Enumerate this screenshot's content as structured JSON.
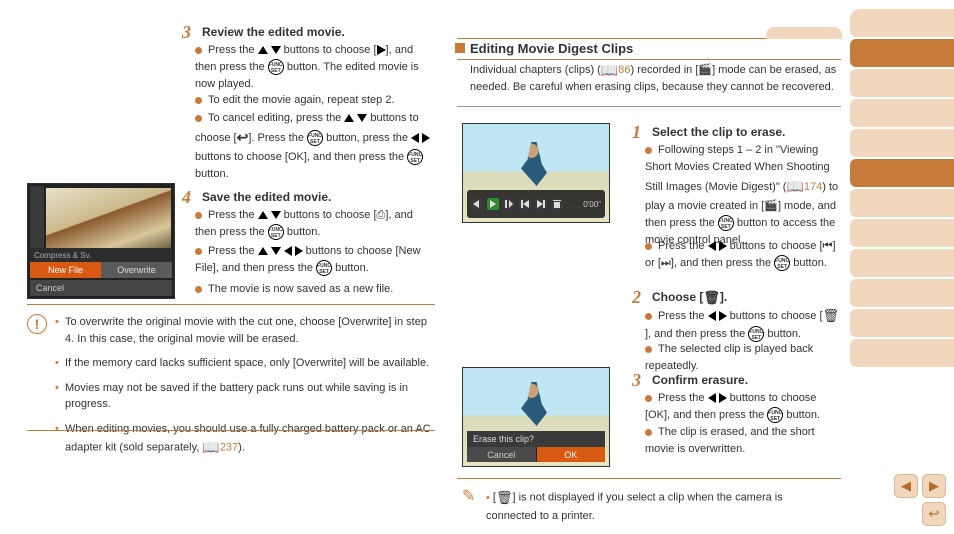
{
  "left": {
    "step3": {
      "num": "3",
      "title": "Review the edited movie.",
      "b1a": "Press the ",
      "b1b": " buttons to choose [",
      "b1c": "], and then press the ",
      "b1d": " button. The edited movie is now played.",
      "b2": "To edit the movie again, repeat step 2.",
      "b3a": "To cancel editing, press the ",
      "b3b": " buttons to choose [",
      "b3c": "]. Press the ",
      "b3d": " button, press the ",
      "b3e": " buttons to choose [OK], and then press the ",
      "b3f": " button."
    },
    "step4": {
      "num": "4",
      "title": "Save the edited movie.",
      "b1a": "Press the ",
      "b1b": " buttons to choose [",
      "b1c": "], and then press the ",
      "b1d": " button.",
      "b2a": "Press the ",
      "b2b": " buttons to choose [New File], and then press the ",
      "b2c": " button.",
      "b3": "The movie is now saved as a new file."
    },
    "shot": {
      "bar": "Compress & Sv.",
      "new": "New File",
      "ow": "Overwrite",
      "cancel": "Cancel"
    },
    "caution": {
      "c1": "To overwrite the original movie with the cut one, choose [Overwrite] in step 4. In this case, the original movie will be erased.",
      "c2": "If the memory card lacks sufficient space, only [Overwrite] will be available.",
      "c3": "Movies may not be saved if the battery pack runs out while saving is in progress.",
      "c4a": "When editing movies, you should use a fully charged battery pack or an AC adapter kit (sold separately, ",
      "c4b": "237",
      "c4c": ")."
    }
  },
  "right": {
    "header": {
      "title": "Editing Movie Digest Clips",
      "subA": "Individual chapters (clips) (",
      "subB": "86",
      "subC": ") recorded in [",
      "subD": "] mode can be erased, as needed. Be careful when erasing clips, because they cannot be recovered."
    },
    "step1": {
      "num": "1",
      "title": "Select the clip to erase.",
      "b1a": "Following steps 1 – 2 in \"Viewing Short Movies Created When Shooting Still Images (Movie Digest)\" (",
      "b1b": "174",
      "b1c": ") to play a movie created in [",
      "b1d": "] mode, and then press the ",
      "b1e": " button to access the movie control panel.",
      "b2a": "Press the ",
      "b2b": " buttons to choose [",
      "b2c": "] or [",
      "b2d": "], and then press the ",
      "b2e": " button."
    },
    "step2": {
      "num": "2",
      "title": "Choose [",
      "titleEnd": "].",
      "b1a": "Press the ",
      "b1b": " buttons to choose [",
      "b1c": "], and then press the ",
      "b1d": " button.",
      "b2": "The selected clip is played back repeatedly."
    },
    "step3": {
      "num": "3",
      "title": "Confirm erasure.",
      "b1a": "Press the ",
      "b1b": " buttons to choose [OK], and then press the ",
      "b1c": " button.",
      "b2": "The clip is erased, and the short movie is overwritten."
    },
    "shot2": {
      "time": "0'00\""
    },
    "shot3": {
      "q": "Erase this clip?",
      "cancel": "Cancel",
      "ok": "OK"
    },
    "note": "[",
    "noteMid": "] is not displayed if you select a clip when the camera is connected to a printer."
  },
  "func": "FUNC.\nSET"
}
